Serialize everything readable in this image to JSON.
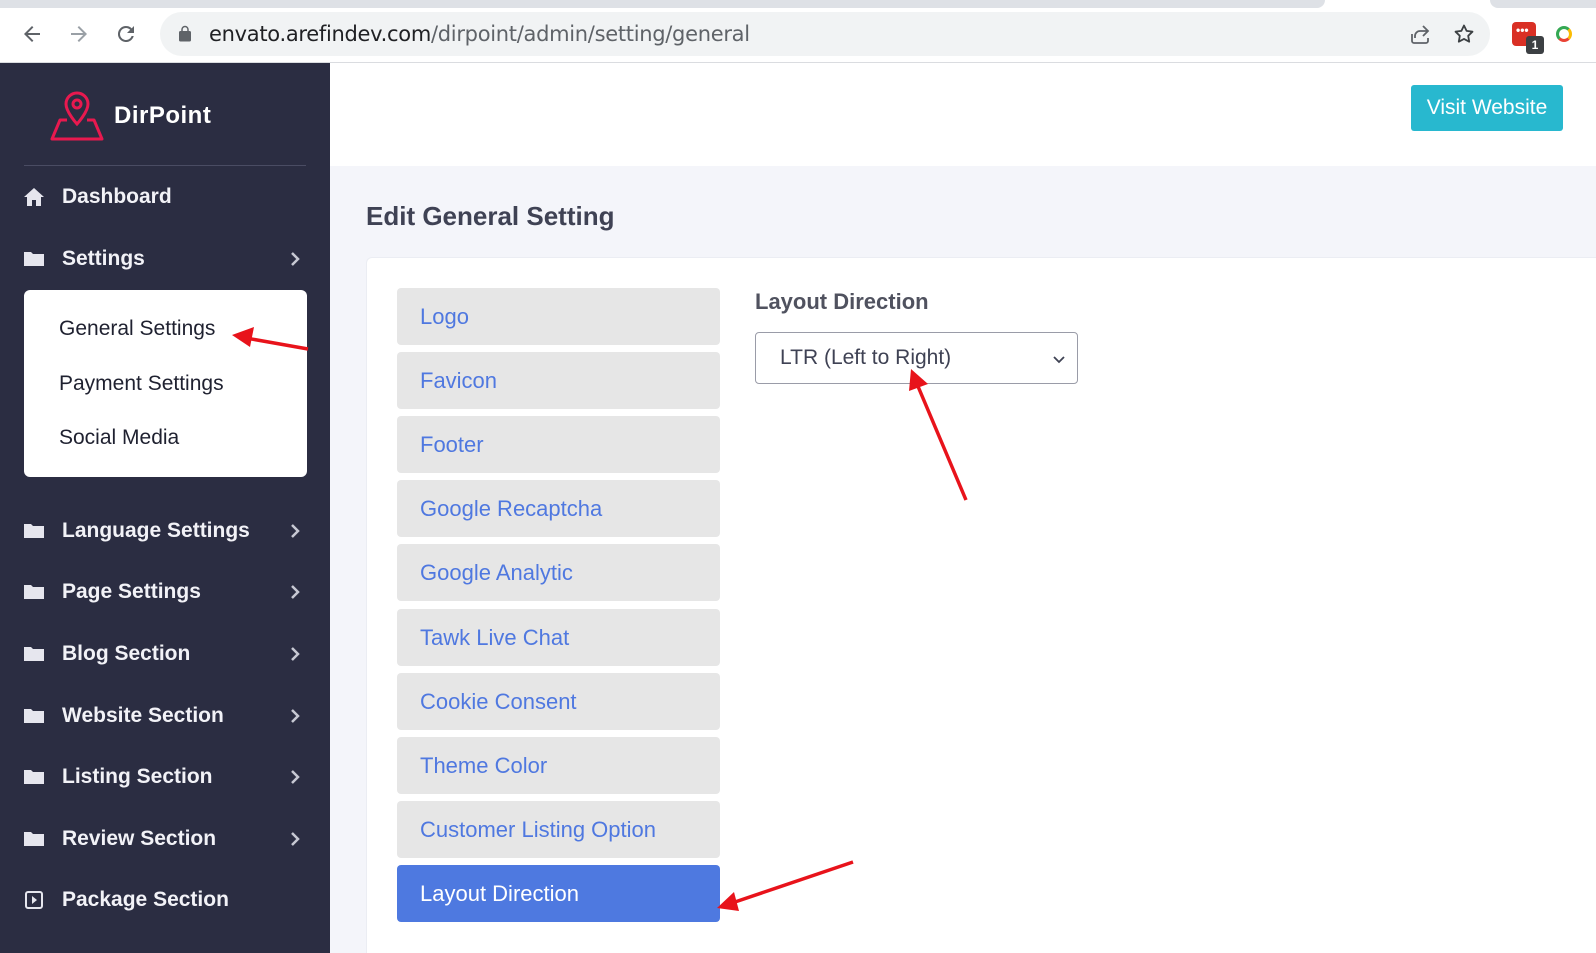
{
  "browser": {
    "url_host": "envato.arefindev.com",
    "url_path": "/dirpoint/admin/setting/general",
    "extension_badge": "1"
  },
  "sidebar": {
    "brand": "DirPoint",
    "items": [
      {
        "label": "Dashboard",
        "icon": "home-icon"
      },
      {
        "label": "Settings",
        "icon": "folder-icon"
      },
      {
        "label": "Language Settings",
        "icon": "folder-icon"
      },
      {
        "label": "Page Settings",
        "icon": "folder-icon"
      },
      {
        "label": "Blog Section",
        "icon": "folder-icon"
      },
      {
        "label": "Website Section",
        "icon": "folder-icon"
      },
      {
        "label": "Listing Section",
        "icon": "folder-icon"
      },
      {
        "label": "Review Section",
        "icon": "folder-icon"
      },
      {
        "label": "Package Section",
        "icon": "square-arrow-icon"
      }
    ],
    "submenu": [
      {
        "label": "General Settings"
      },
      {
        "label": "Payment Settings"
      },
      {
        "label": "Social Media"
      }
    ]
  },
  "header": {
    "visit_website": "Visit Website"
  },
  "main": {
    "title": "Edit General Setting",
    "tabs": [
      {
        "label": "Logo"
      },
      {
        "label": "Favicon"
      },
      {
        "label": "Footer"
      },
      {
        "label": "Google Recaptcha"
      },
      {
        "label": "Google Analytic"
      },
      {
        "label": "Tawk Live Chat"
      },
      {
        "label": "Cookie Consent"
      },
      {
        "label": "Theme Color"
      },
      {
        "label": "Customer Listing Option"
      },
      {
        "label": "Layout Direction"
      }
    ],
    "active_tab": "Layout Direction",
    "field": {
      "label": "Layout Direction",
      "value": "LTR (Left to Right)"
    }
  },
  "colors": {
    "sidebar_bg": "#2b2d42",
    "accent_blue": "#4e79e0",
    "visit_button": "#28b8cf",
    "brand_red": "#e8194f",
    "annotation_red": "#e8131b"
  }
}
